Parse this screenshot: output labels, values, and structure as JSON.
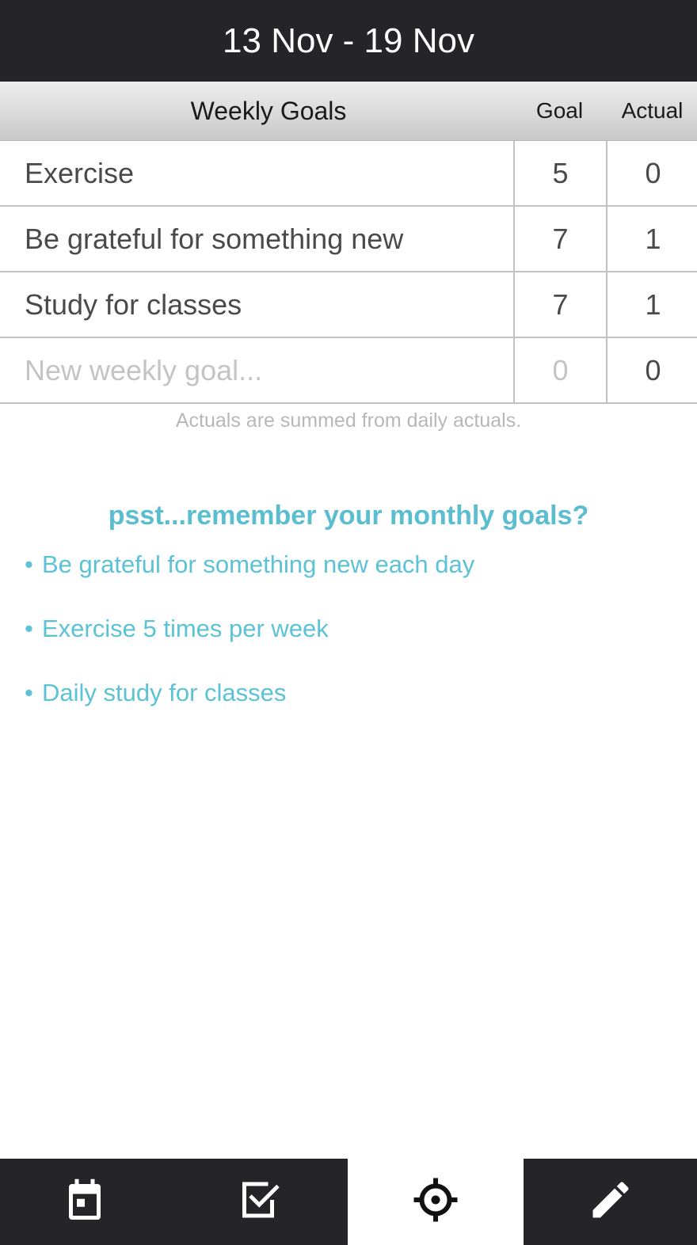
{
  "header": {
    "title": "13 Nov - 19 Nov"
  },
  "table": {
    "columns": {
      "title": "Weekly Goals",
      "goal": "Goal",
      "actual": "Actual"
    },
    "rows": [
      {
        "label": "Exercise",
        "goal": "5",
        "actual": "0"
      },
      {
        "label": "Be grateful for something new",
        "goal": "7",
        "actual": "1"
      },
      {
        "label": "Study for classes",
        "goal": "7",
        "actual": "1"
      }
    ],
    "new_row": {
      "placeholder": "New weekly goal...",
      "goal": "0",
      "actual": "0"
    }
  },
  "note": "Actuals are summed from daily actuals.",
  "reminder": {
    "title": "psst...remember your monthly goals?",
    "bullet": "•",
    "items": [
      "Be grateful for something new each day",
      "Exercise 5 times per week",
      "Daily study for classes"
    ]
  },
  "tabbar": {
    "tabs": [
      {
        "icon": "calendar-icon",
        "active": false
      },
      {
        "icon": "checkbox-icon",
        "active": false
      },
      {
        "icon": "crosshair-target-icon",
        "active": true
      },
      {
        "icon": "pencil-icon",
        "active": false
      }
    ]
  },
  "colors": {
    "header_bg": "#252529",
    "accent": "#5bc3d5",
    "tabbar_bg": "#252529",
    "active_tab_bg": "#ffffff"
  }
}
